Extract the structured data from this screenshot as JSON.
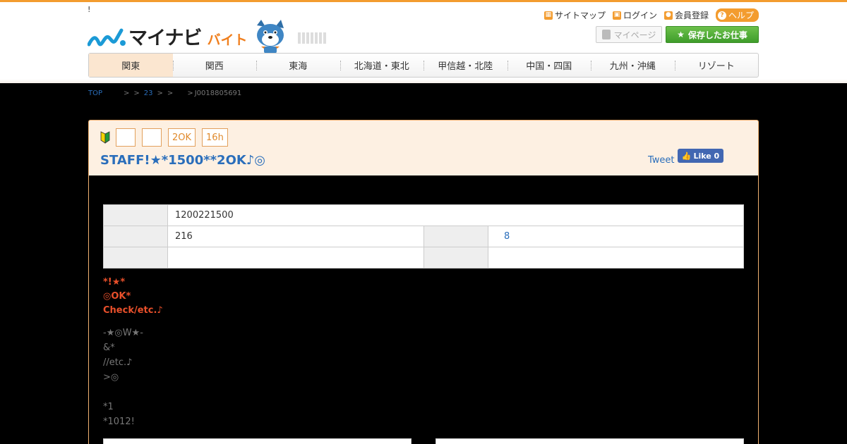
{
  "header": {
    "tagline": "!",
    "logo": {
      "brand": "マイナビ",
      "sub": "バイト"
    },
    "util_links": [
      {
        "label": "サイトマップ",
        "icon": "sitemap-icon"
      },
      {
        "label": "ログイン",
        "icon": "lock-icon"
      },
      {
        "label": "会員登録",
        "icon": "person-icon"
      }
    ],
    "help_label": "ヘルプ",
    "mypage_label": "マイページ",
    "saved_label": "保存したお仕事"
  },
  "nav": {
    "tabs": [
      "関東",
      "関西",
      "東海",
      "北海道・東北",
      "甲信越・北陸",
      "中国・四国",
      "九州・沖縄",
      "リゾート"
    ],
    "active": 0
  },
  "breadcrumb": {
    "top": "TOP",
    "sep1": ">",
    "sep2": ">",
    "level": "23",
    "sep3": ">",
    "sep4": ">",
    "sep5": ">",
    "job_id": "J0018805691"
  },
  "job": {
    "badges": [
      "",
      "",
      "2OK",
      "16h"
    ],
    "title": "STAFF!★*1500**2OK♪◎",
    "tweet_label": "Tweet",
    "like_label": "Like 0"
  },
  "info_table": {
    "row1_value": "1200221500",
    "row2_value": "216",
    "row2_right_value": "8",
    "row3_value": "",
    "row3_right_value": ""
  },
  "highlight_lines": [
    "*!★*",
    "◎OK*",
    "Check/etc.♪"
  ],
  "description_lines": [
    "-★◎W★-",
    "&*",
    "//etc.♪",
    ">◎",
    "",
    "*1",
    "*1012!"
  ],
  "colors": {
    "accent": "#f39c2f",
    "link": "#2a6ebb",
    "highlight": "#e9502b",
    "saved_green": "#4caf35"
  }
}
